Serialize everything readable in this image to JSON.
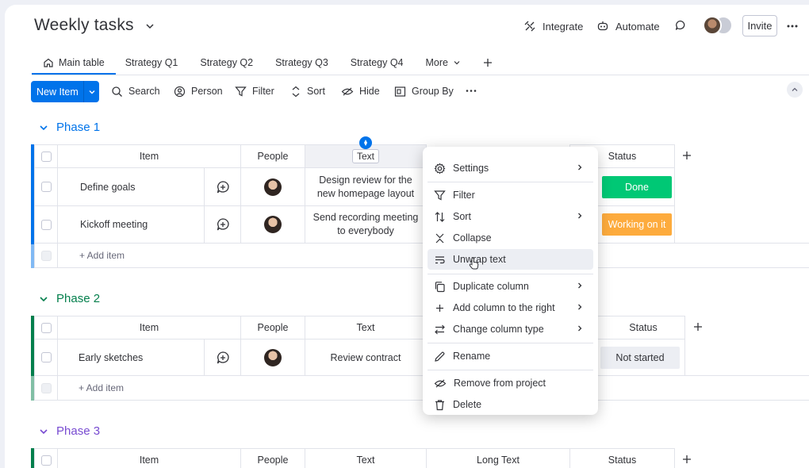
{
  "header": {
    "title": "Weekly tasks",
    "integrate": "Integrate",
    "automate": "Automate",
    "invite": "Invite"
  },
  "tabs": [
    {
      "label": "Main table",
      "icon": "home-icon"
    },
    {
      "label": "Strategy Q1"
    },
    {
      "label": "Strategy Q2"
    },
    {
      "label": "Strategy Q3"
    },
    {
      "label": "Strategy Q4"
    },
    {
      "label": "More",
      "icon": "chevron-down-icon"
    }
  ],
  "toolbar": {
    "new_item": "New Item",
    "search": "Search",
    "person": "Person",
    "filter": "Filter",
    "sort": "Sort",
    "hide": "Hide",
    "group_by": "Group By"
  },
  "columns": {
    "item": "Item",
    "people": "People",
    "text": "Text",
    "long_text": "Long Text",
    "status": "Status"
  },
  "groups": [
    {
      "title": "Phase 1",
      "color": "#0073ea",
      "rows": [
        {
          "item": "Define goals",
          "text": "Design review for the new homepage layout",
          "status": "Done",
          "status_color": "#00c875"
        },
        {
          "item": "Kickoff meeting",
          "text": "Send recording meeting to everybody",
          "status": "Working on it",
          "status_color": "#fdab3d"
        }
      ],
      "add_item": "+ Add item"
    },
    {
      "title": "Phase 2",
      "color": "#037f4c",
      "rows": [
        {
          "item": "Early sketches",
          "text": "Review contract",
          "status": "Not started",
          "status_color": "#c4c4c4"
        }
      ],
      "add_item": "+ Add item"
    },
    {
      "title": "Phase 3",
      "color": "#784bd1",
      "rows": []
    }
  ],
  "menu": {
    "items": [
      {
        "label": "Settings",
        "icon": "gear-icon",
        "submenu": true
      },
      {
        "label": "Filter",
        "icon": "filter-icon"
      },
      {
        "label": "Sort",
        "icon": "sort-icon",
        "submenu": true
      },
      {
        "label": "Collapse",
        "icon": "collapse-icon"
      },
      {
        "label": "Unwrap text",
        "icon": "unwrap-text-icon",
        "hovered": true
      },
      {
        "label": "Duplicate column",
        "icon": "duplicate-icon",
        "submenu": true
      },
      {
        "label": "Add column to the right",
        "icon": "plus-icon",
        "submenu": true
      },
      {
        "label": "Change column type",
        "icon": "change-type-icon",
        "submenu": true
      },
      {
        "label": "Rename",
        "icon": "pencil-icon"
      },
      {
        "label": "Remove from project",
        "icon": "eye-off-icon"
      },
      {
        "label": "Delete",
        "icon": "trash-icon"
      }
    ]
  }
}
